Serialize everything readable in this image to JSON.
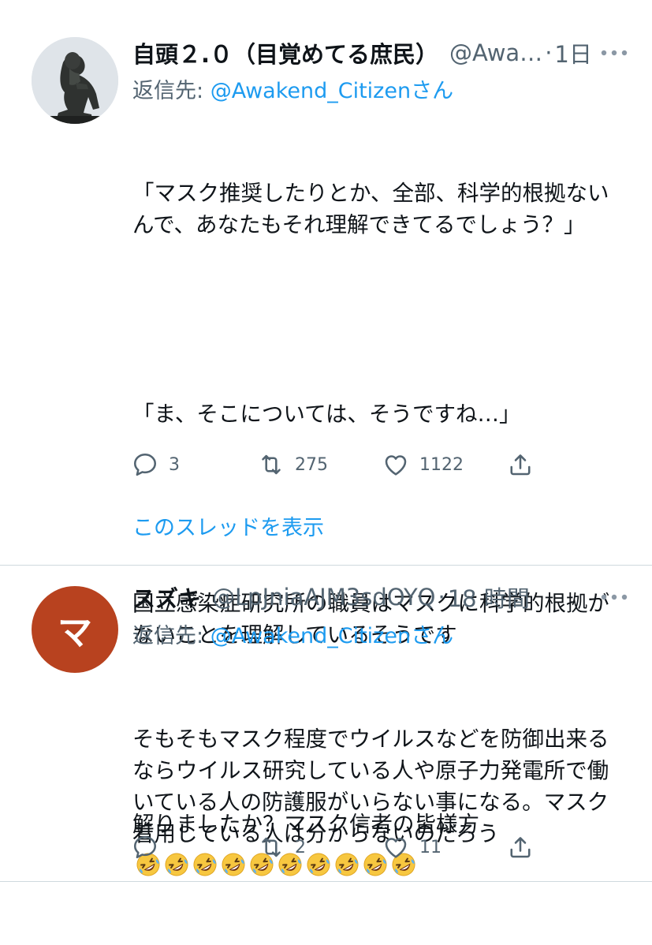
{
  "tweets": [
    {
      "avatar": "thinker-statue-photo",
      "name": "自頭２.０（目覚めてる庶民）",
      "handle": "@Awa…",
      "time": "1日",
      "reply_label": "返信先: ",
      "reply_mention": "@Awakend_Citizen",
      "reply_suffix": "さん",
      "body": [
        "「マスク推奨したりとか、全部、科学的根拠ないんで、あなたもそれ理解できてるでしょう？」",
        "「ま、そこについては、そうですね…」",
        "国立感染症研究所の職員はマスクに科学的根拠がないことを理解しているそうです",
        "解りましたか？マスク信者の皆様方"
      ],
      "replies": "3",
      "retweets": "275",
      "likes": "1122",
      "show_thread": "このスレッドを表示"
    },
    {
      "avatar_letter": "マ",
      "name": "スズキ",
      "handle": "@LpJniaAJM3sdOYQ",
      "time": "18 時間",
      "reply_label": "返信先: ",
      "reply_mention": "@Awakend_Citizen",
      "reply_suffix": "さん",
      "body": [
        "そもそもマスク程度でウイルスなどを防御出来るならウイルス研究している人や原子力発電所で働いている人の防護服がいらない事になる。マスク着用している人は分からないのだろう"
      ],
      "emoji": "rolling-on-floor-laughing-emoji",
      "emoji_count": 10,
      "replies": "",
      "retweets": "2",
      "likes": "11"
    }
  ],
  "icons": {
    "more": "more-horizontal-icon",
    "reply": "reply-bubble-icon",
    "retweet": "retweet-icon",
    "like": "heart-icon",
    "share": "share-icon"
  },
  "colors": {
    "link": "#1d9bf0",
    "secondary_text": "#536471",
    "divider": "#cfd9de",
    "avatar_bg": "#b8421f"
  }
}
